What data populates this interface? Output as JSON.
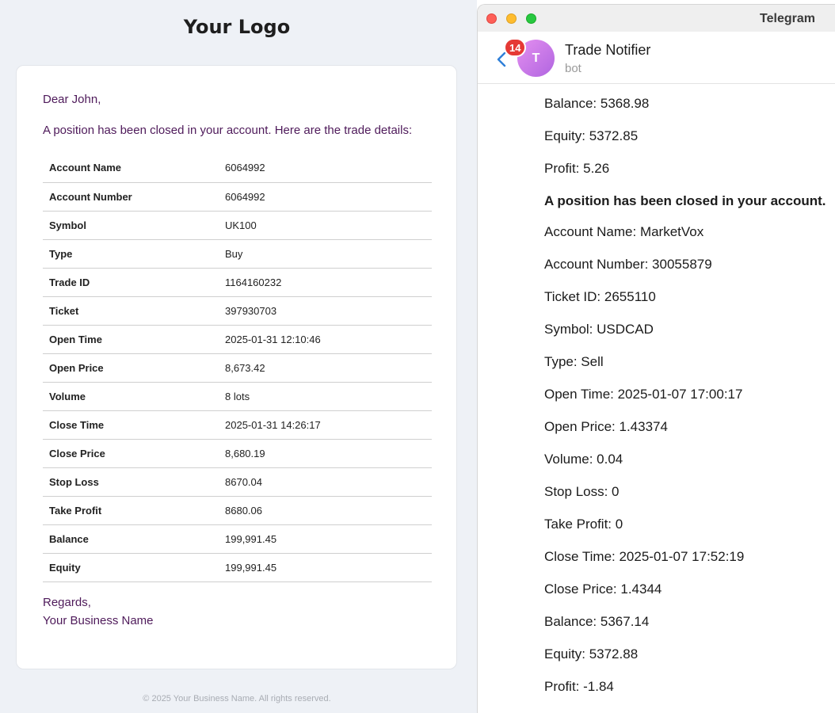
{
  "email": {
    "logo": "Your Logo",
    "greeting": "Dear John,",
    "intro": "A position has been closed in your account. Here are the trade details:",
    "rows": [
      {
        "label": "Account Name",
        "value": "6064992"
      },
      {
        "label": "Account Number",
        "value": "6064992"
      },
      {
        "label": "Symbol",
        "value": "UK100"
      },
      {
        "label": "Type",
        "value": "Buy"
      },
      {
        "label": "Trade ID",
        "value": "1164160232"
      },
      {
        "label": "Ticket",
        "value": "397930703"
      },
      {
        "label": "Open Time",
        "value": "2025-01-31 12:10:46"
      },
      {
        "label": "Open Price",
        "value": "8,673.42"
      },
      {
        "label": "Volume",
        "value": "8 lots"
      },
      {
        "label": "Close Time",
        "value": "2025-01-31 14:26:17"
      },
      {
        "label": "Close Price",
        "value": "8,680.19"
      },
      {
        "label": "Stop Loss",
        "value": "8670.04"
      },
      {
        "label": "Take Profit",
        "value": "8680.06"
      },
      {
        "label": "Balance",
        "value": "199,991.45"
      },
      {
        "label": "Equity",
        "value": "199,991.45"
      }
    ],
    "regards": "Regards,",
    "business_name": "Your Business Name",
    "footer": "© 2025 Your Business Name. All rights reserved."
  },
  "telegram": {
    "app_title": "Telegram",
    "unread_count": "14",
    "avatar_initial": "T",
    "chat_name": "Trade Notifier",
    "chat_subtitle": "bot",
    "back_icon": "chevron-left-icon",
    "messages": [
      "Balance: 5368.98",
      "Equity: 5372.85",
      "Profit: 5.26",
      "A position has been closed in your account.",
      "Account Name: MarketVox",
      "Account Number: 30055879",
      "Ticket ID: 2655110",
      "Symbol: USDCAD",
      "Type: Sell",
      "Open Time: 2025-01-07 17:00:17",
      "Open Price: 1.43374",
      "Volume: 0.04",
      "Stop Loss: 0",
      "Take Profit: 0",
      "Close Time: 2025-01-07 17:52:19",
      "Close Price: 1.4344",
      "Balance: 5367.14",
      "Equity: 5372.88",
      "Profit: -1.84"
    ]
  },
  "colors": {
    "email_text": "#4e1a5a",
    "badge": "#e53935",
    "avatar_start": "#e48ff0",
    "avatar_end": "#b065e0",
    "back_arrow": "#2f7fd8"
  }
}
